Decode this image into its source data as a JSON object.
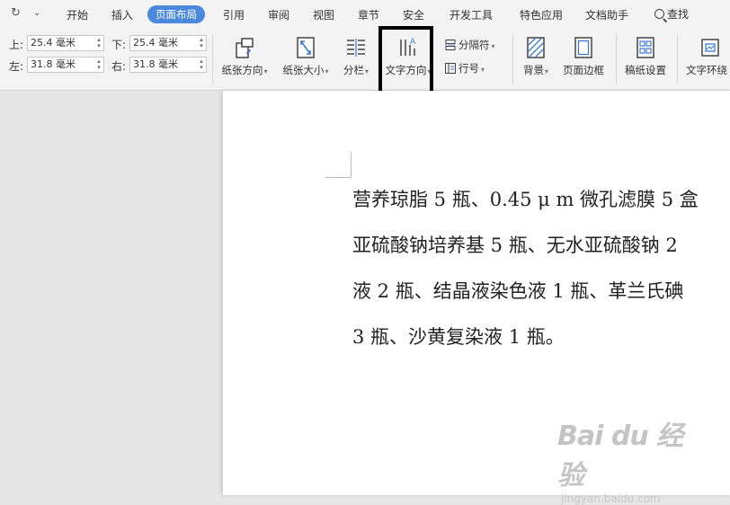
{
  "quick_access": {
    "redo_icon": "redo-icon",
    "more_icon": "chevron-down-icon"
  },
  "menu": {
    "items": [
      "开始",
      "插入",
      "页面布局",
      "引用",
      "审阅",
      "视图",
      "章节",
      "安全",
      "开发工具",
      "特色应用",
      "文档助手"
    ],
    "active_index": 2,
    "search_label": "查找"
  },
  "margins": {
    "top_label": "上:",
    "top_value": "25.4 毫米",
    "bottom_label": "下:",
    "bottom_value": "25.4 毫米",
    "left_label": "左:",
    "left_value": "31.8 毫米",
    "right_label": "右:",
    "right_value": "31.8 毫米"
  },
  "ribbon": {
    "orientation": "纸张方向",
    "size": "纸张大小",
    "columns": "分栏",
    "text_direction": "文字方向",
    "breaks": "分隔符",
    "line_numbers": "行号",
    "background": "背景",
    "page_border": "页面边框",
    "draft_paper": "稿纸设置",
    "text_wrap": "文字环绕"
  },
  "document": {
    "lines": [
      "营养琼脂 5 瓶、0.45 μ m 微孔滤膜 5 盒",
      "亚硫酸钠培养基 5 瓶、无水亚硫酸钠 2",
      "液 2 瓶、结晶液染色液 1 瓶、革兰氏碘",
      "3 瓶、沙黄复染液 1 瓶。"
    ]
  },
  "watermark": {
    "brand": "Bai du 经验",
    "url": "jingyan.baidu.com"
  },
  "colors": {
    "accent": "#4a88dd",
    "ribbon_bg": "#f3f3f3",
    "workspace_bg": "#e6e6e6"
  }
}
